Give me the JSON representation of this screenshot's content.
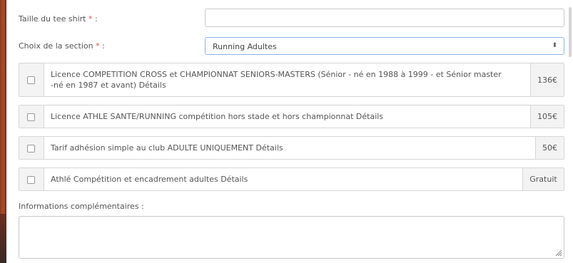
{
  "form": {
    "tee_shirt": {
      "label": "Taille du tee shirt",
      "required_mark": "*",
      "label_suffix": " :",
      "value": ""
    },
    "section": {
      "label": "Choix de la section",
      "required_mark": "*",
      "label_suffix": " :",
      "selected": "Running Adultes",
      "arrows": "⬍"
    },
    "options": [
      {
        "line1": "Licence COMPETITION CROSS et CHAMPIONNAT SENIORS-MASTERS (Sénior - né en 1988 à 1999 - et Sénior master",
        "line2": "-né en 1987 et avant)  Détails",
        "price": "136€",
        "checked": false
      },
      {
        "line1": "Licence ATHLE SANTE/RUNNING compétition hors stade et hors championnat  Détails",
        "price": "105€",
        "checked": false
      },
      {
        "line1": "Tarif adhésion simple au club ADULTE UNIQUEMENT  Détails",
        "price": "50€",
        "checked": false
      },
      {
        "line1": "Athlé Compétition et encadrement adultes  Détails",
        "price": "Gratuit",
        "checked": false
      }
    ],
    "info": {
      "label": "Informations complémentaires :",
      "value": ""
    }
  }
}
